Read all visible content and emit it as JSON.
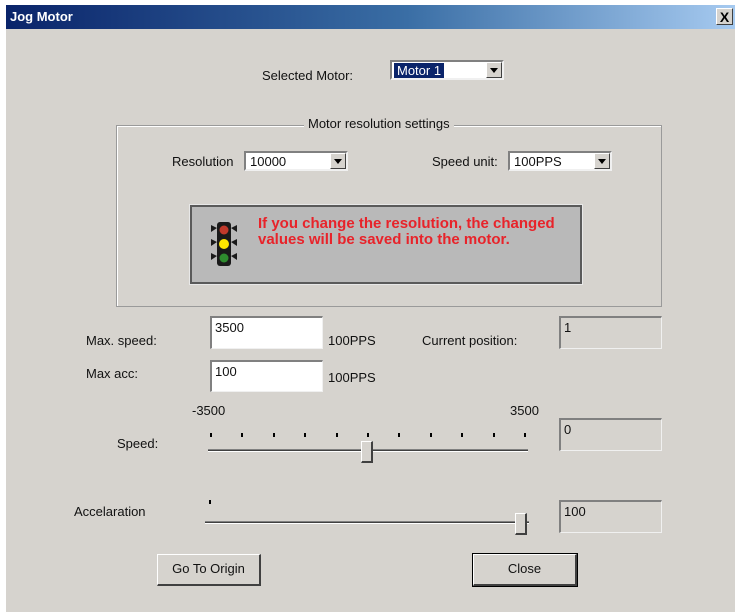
{
  "window": {
    "title": "Jog Motor",
    "close_glyph": "X"
  },
  "selected_motor": {
    "label": "Selected Motor:",
    "value": "Motor 1"
  },
  "resolution_group": {
    "title": "Motor resolution settings",
    "resolution_label": "Resolution",
    "resolution_value": "10000",
    "speed_unit_label": "Speed unit:",
    "speed_unit_value": "100PPS",
    "warning_text": "If you change the resolution, the changed values will be saved into the motor.",
    "warning_icon": "traffic-light-icon"
  },
  "max_speed": {
    "label": "Max. speed:",
    "value": "3500",
    "unit": "100PPS"
  },
  "max_acc": {
    "label": "Max acc:",
    "value": "100",
    "unit": "100PPS"
  },
  "current_position": {
    "label": "Current position:",
    "value": "1"
  },
  "speed_slider": {
    "label": "Speed:",
    "min_label": "-3500",
    "max_label": "3500",
    "min": -3500,
    "max": 3500,
    "value": 0,
    "value_display": "0"
  },
  "accel_slider": {
    "label": "Accelaration",
    "min": 0,
    "max": 100,
    "value": 100,
    "value_display": "100"
  },
  "buttons": {
    "go_to_origin": "Go To Origin",
    "close": "Close"
  },
  "colors": {
    "warning_text": "#e8232a",
    "title_bar": "#0a246a",
    "dialog_bg": "#d6d3ce"
  }
}
